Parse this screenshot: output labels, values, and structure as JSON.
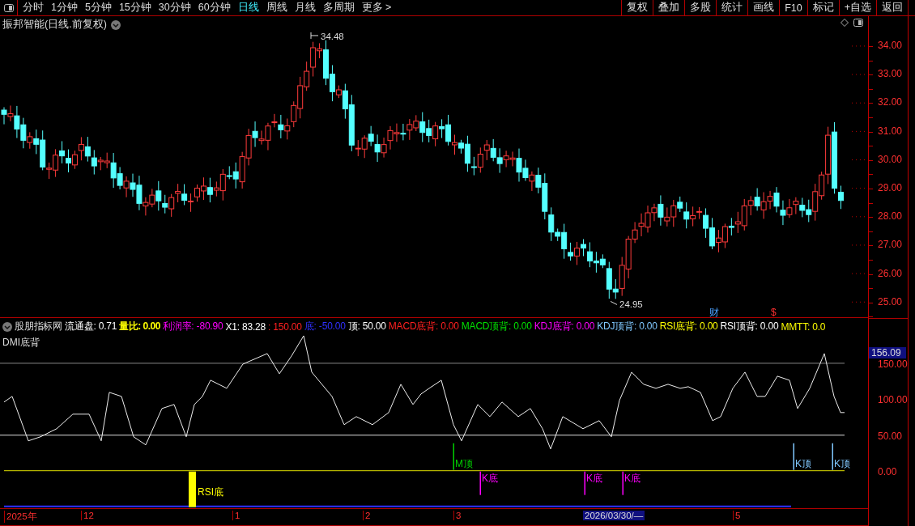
{
  "toolbar": {
    "periods": [
      {
        "label": "分时",
        "selected": false
      },
      {
        "label": "1分钟",
        "selected": false
      },
      {
        "label": "5分钟",
        "selected": false
      },
      {
        "label": "15分钟",
        "selected": false
      },
      {
        "label": "30分钟",
        "selected": false
      },
      {
        "label": "60分钟",
        "selected": false
      },
      {
        "label": "日线",
        "selected": true
      },
      {
        "label": "周线",
        "selected": false
      },
      {
        "label": "月线",
        "selected": false
      },
      {
        "label": "多周期",
        "selected": false
      },
      {
        "label": "更多 >",
        "selected": false
      }
    ],
    "buttons": [
      "复权",
      "叠加",
      "多股",
      "统计",
      "画线",
      "F10",
      "标记",
      "+自选",
      "返回"
    ]
  },
  "price_chart": {
    "title": "振邦智能(日线.前复权)",
    "high_label": "34.48",
    "low_label": "24.95",
    "markers": [
      {
        "label": "财",
        "kind": "finance"
      },
      {
        "label": "$",
        "kind": "dividend"
      }
    ],
    "axis_labels": [
      "34.00",
      "33.00",
      "32.00",
      "31.00",
      "30.00",
      "29.00",
      "28.00",
      "27.00",
      "26.00",
      "25.00"
    ]
  },
  "indicator": {
    "name": "股朋指标网",
    "subtitle": "DMI底背",
    "legend": [
      {
        "text": "流通盘: 0.71",
        "color": "#ffffff"
      },
      {
        "text": "量比: 0.00",
        "color": "#ffff00"
      },
      {
        "text": "利润率: -80.90",
        "color": "#ff00ff"
      },
      {
        "text": "X1: 83.28",
        "color": "#ffffff"
      },
      {
        "text": ": 150.00",
        "color": "#ff2020"
      },
      {
        "text": "底: -50.00",
        "color": "#3030ff"
      },
      {
        "text": "顶: 50.00",
        "color": "#ffffff"
      },
      {
        "text": "MACD底背: 0.00",
        "color": "#ff2020"
      },
      {
        "text": "MACD顶背: 0.00",
        "color": "#00e000"
      },
      {
        "text": "KDJ底背: 0.00",
        "color": "#ff00ff"
      },
      {
        "text": "KDJ顶背: 0.00",
        "color": "#80c8ff"
      },
      {
        "text": "RSI底背: 0.00",
        "color": "#ffff00"
      },
      {
        "text": "RSI顶背: 0.00",
        "color": "#ffffff"
      },
      {
        "text": "MMTT: 0.0",
        "color": "#ffff00"
      }
    ],
    "axis_current": "156.09",
    "axis_labels": [
      "150.00",
      "100.00",
      "50.00",
      "0.00"
    ],
    "signals": [
      {
        "label": "RSI底",
        "kind": "rsi",
        "color": "#ffff00"
      },
      {
        "label": "M顶",
        "kind": "top",
        "color": "#00d000"
      },
      {
        "label": "K底",
        "kind": "bottom",
        "color": "#ff00ff"
      },
      {
        "label": "K底",
        "kind": "bottom",
        "color": "#ff00ff"
      },
      {
        "label": "K底",
        "kind": "bottom",
        "color": "#ff00ff"
      },
      {
        "label": "K顶",
        "kind": "top",
        "color": "#80c8ff"
      },
      {
        "label": "K顶",
        "kind": "top",
        "color": "#80c8ff"
      }
    ]
  },
  "date_axis": {
    "labels": [
      {
        "text": "2025年",
        "selected": false
      },
      {
        "text": "12",
        "selected": false
      },
      {
        "text": "1",
        "selected": false
      },
      {
        "text": "2",
        "selected": false
      },
      {
        "text": "3",
        "selected": false
      },
      {
        "text": "2026/03/30/—",
        "selected": true
      },
      {
        "text": "5",
        "selected": false
      }
    ]
  }
}
